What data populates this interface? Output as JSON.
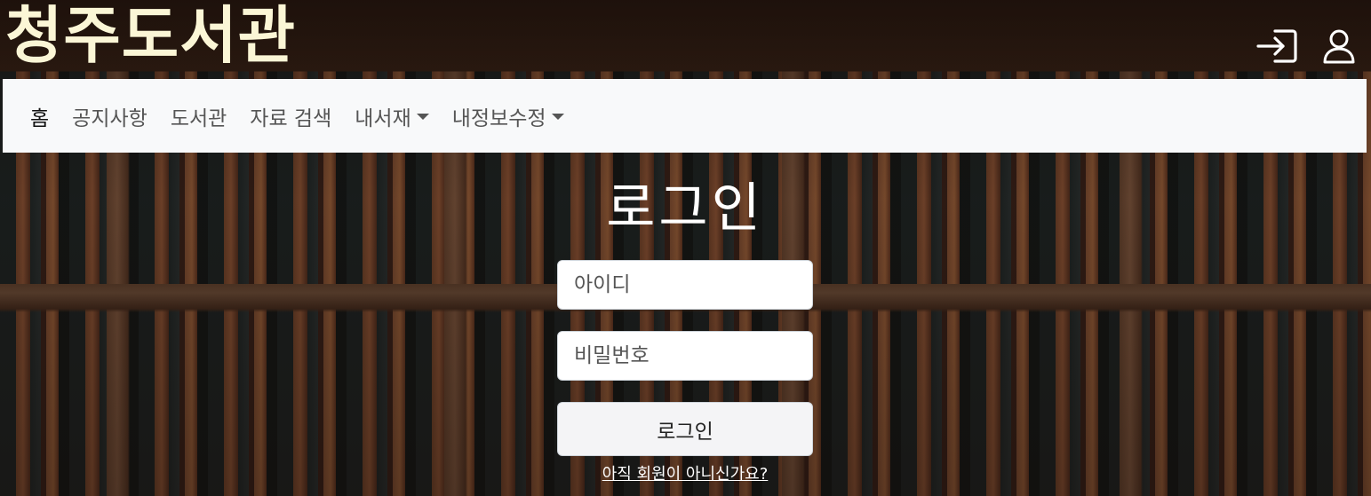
{
  "brand": {
    "title": "청주도서관"
  },
  "top_icons": {
    "login_icon": "login-icon",
    "user_icon": "user-icon"
  },
  "nav": {
    "items": [
      {
        "label": "홈",
        "active": true,
        "dropdown": false
      },
      {
        "label": "공지사항",
        "active": false,
        "dropdown": false
      },
      {
        "label": "도서관",
        "active": false,
        "dropdown": false
      },
      {
        "label": "자료 검색",
        "active": false,
        "dropdown": false
      },
      {
        "label": "내서재",
        "active": false,
        "dropdown": true
      },
      {
        "label": "내정보수정",
        "active": false,
        "dropdown": true
      }
    ]
  },
  "login": {
    "title": "로그인",
    "id_placeholder": "아이디",
    "id_value": "",
    "password_placeholder": "비밀번호",
    "password_value": "",
    "submit_label": "로그인",
    "signup_link": "아직 회원이 아니신가요?"
  },
  "colors": {
    "brand_text": "#fbf6d6",
    "navbar_bg": "#f8f9fa",
    "title_text": "#ffffff"
  }
}
